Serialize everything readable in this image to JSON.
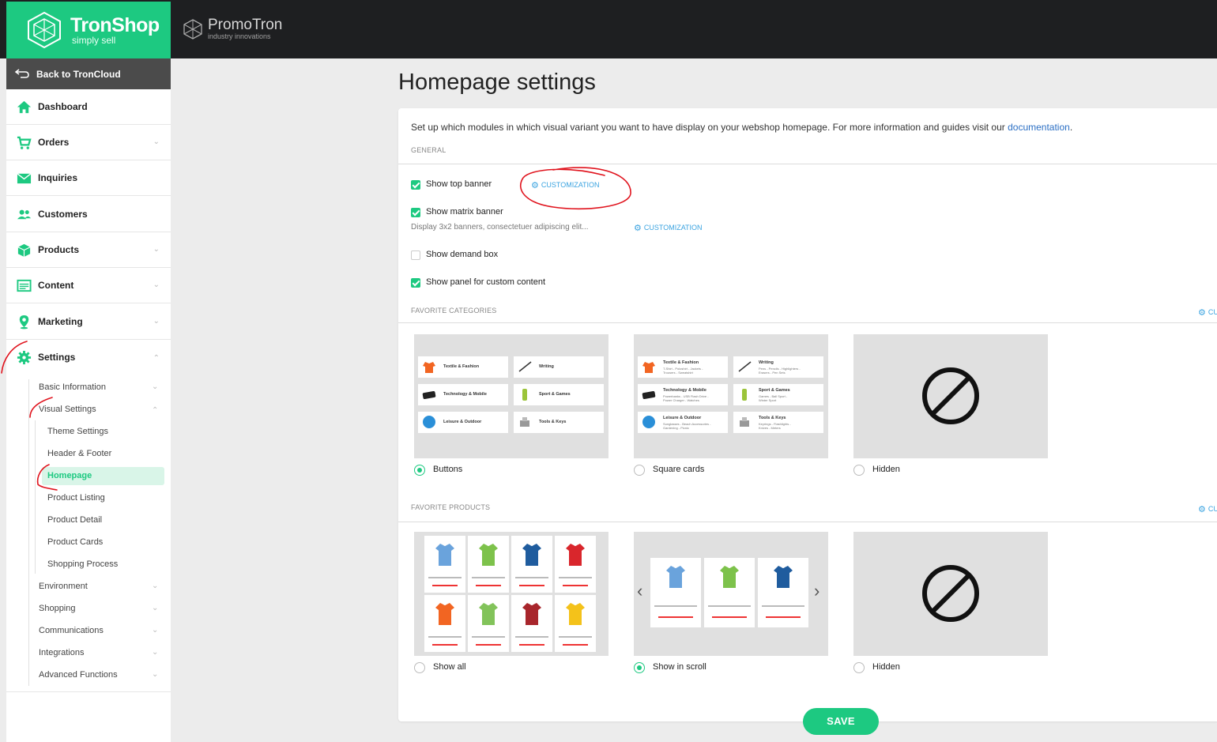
{
  "brand": {
    "name": "TronShop",
    "tagline": "simply sell",
    "partner_name": "PromoTron",
    "partner_sub": "industry innovations"
  },
  "sidebar": {
    "back_label": "Back to TronCloud",
    "items": [
      {
        "label": "Dashboard",
        "icon": "home-icon"
      },
      {
        "label": "Orders",
        "icon": "cart-icon"
      },
      {
        "label": "Inquiries",
        "icon": "envelope-icon"
      },
      {
        "label": "Customers",
        "icon": "users-icon"
      },
      {
        "label": "Products",
        "icon": "box-icon"
      },
      {
        "label": "Content",
        "icon": "layout-icon"
      },
      {
        "label": "Marketing",
        "icon": "pin-icon"
      },
      {
        "label": "Settings",
        "icon": "gear-icon"
      }
    ],
    "settings_sub": [
      "Basic Information",
      "Visual Settings",
      "Environment",
      "Shopping",
      "Communications",
      "Integrations",
      "Advanced Functions"
    ],
    "visual_sub": [
      "Theme Settings",
      "Header & Footer",
      "Homepage",
      "Product Listing",
      "Product Detail",
      "Product Cards",
      "Shopping Process"
    ]
  },
  "main": {
    "title": "Homepage settings",
    "intro": "Set up which modules in which visual variant you want to have display on your webshop homepage. For more information and guides visit our",
    "intro_link": "documentation",
    "intro_end": ".",
    "general_label": "GENERAL",
    "checks": [
      {
        "label": "Show top banner",
        "checked": true
      },
      {
        "label": "Show matrix banner",
        "checked": true
      },
      {
        "label": "Show demand box",
        "checked": false
      },
      {
        "label": "Show panel for custom content",
        "checked": true
      }
    ],
    "matrix_desc": "Display 3x2 banners, consectetuer adipiscing elit...",
    "customization": "CUSTOMIZATION",
    "customization_clipped": "CU",
    "fav_categories_label": "FAVORITE CATEGORIES",
    "fav_products_label": "FAVORITE PRODUCTS",
    "category_options": [
      {
        "label": "Buttons",
        "selected": true
      },
      {
        "label": "Square cards",
        "selected": false
      },
      {
        "label": "Hidden",
        "selected": false
      }
    ],
    "product_options": [
      {
        "label": "Show all",
        "selected": false
      },
      {
        "label": "Show in scroll",
        "selected": true
      },
      {
        "label": "Hidden",
        "selected": false
      }
    ],
    "categories": [
      {
        "name": "Textile & Fashion",
        "sub": "T-Shirt - Poloshirt - Jackets -",
        "sub2": "Trousers - Sweatshirt"
      },
      {
        "name": "Writing",
        "sub": "Pens - Pencils - Highlighters -",
        "sub2": "Erasers - Pen Sets"
      },
      {
        "name": "Technology & Mobile",
        "sub": "Powerbanks - USB Flash Drive -",
        "sub2": "Power Charger - Watches"
      },
      {
        "name": "Sport & Games",
        "sub": "Games - Ball Sport -",
        "sub2": "Winter Sport"
      },
      {
        "name": "Leisure & Outdoor",
        "sub": "Sunglasses - Beach Accessories -",
        "sub2": "Gardening - Picnic"
      },
      {
        "name": "Tools & Keys",
        "sub": "Keyrings - Flashlights -",
        "sub2": "Knives - Meters"
      }
    ],
    "save_label": "SAVE"
  },
  "colors": {
    "accent": "#1dc981",
    "topbar": "#1e1f21",
    "link": "#2b6fc4",
    "custom_link": "#3aa3e0",
    "annotation": "#e0141e"
  }
}
